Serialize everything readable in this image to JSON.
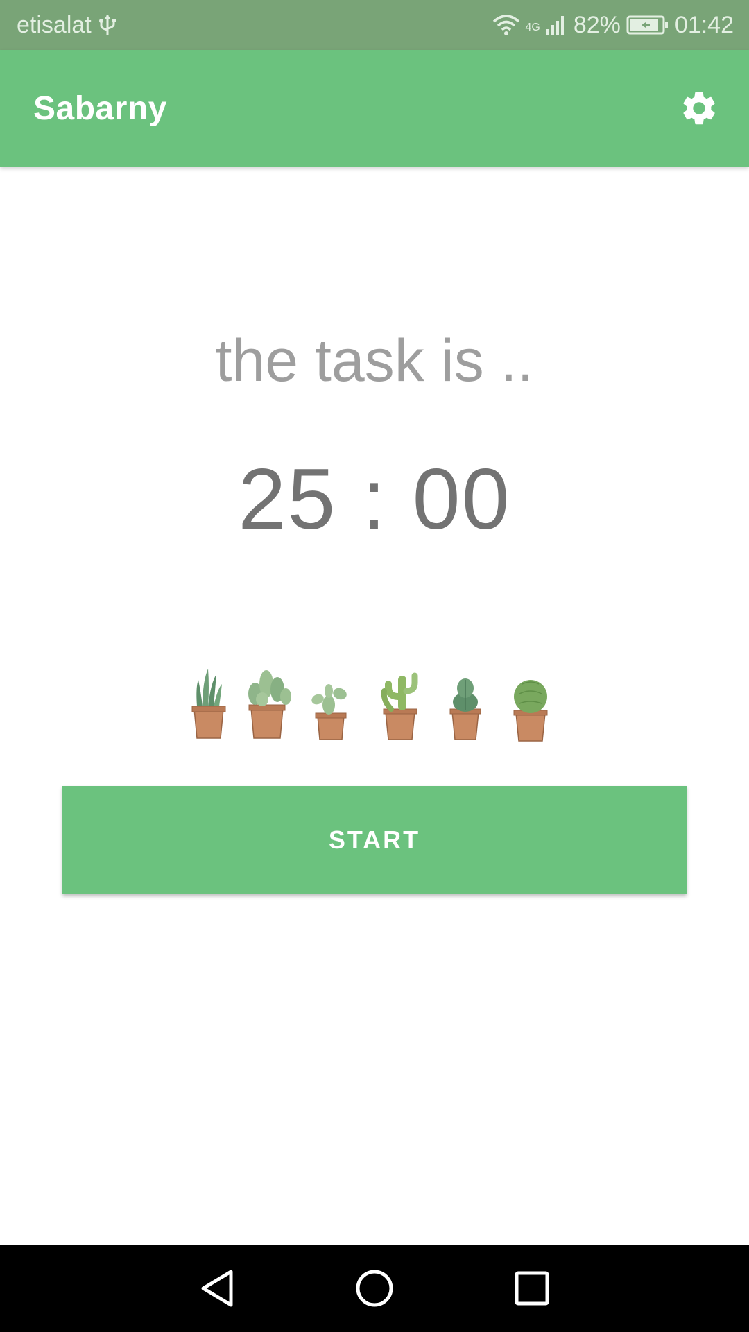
{
  "status_bar": {
    "carrier": "etisalat",
    "network_type": "4G",
    "battery": "82%",
    "time": "01:42",
    "icons": [
      "usb-icon",
      "wifi-icon",
      "signal-icon",
      "battery-icon"
    ]
  },
  "app_bar": {
    "title": "Sabarny",
    "settings_icon": "gear-icon"
  },
  "main": {
    "task_label": "the task is ..",
    "timer": "25 : 00",
    "illustration": "cactus-pots-illustration",
    "start_label": "START"
  },
  "nav_bar": {
    "icons": [
      "back-icon",
      "home-icon",
      "recents-icon"
    ]
  },
  "colors": {
    "primary": "#6bc27e",
    "status_bar": "#79a477",
    "text_muted": "#9e9e9e",
    "timer_text": "#737373"
  }
}
